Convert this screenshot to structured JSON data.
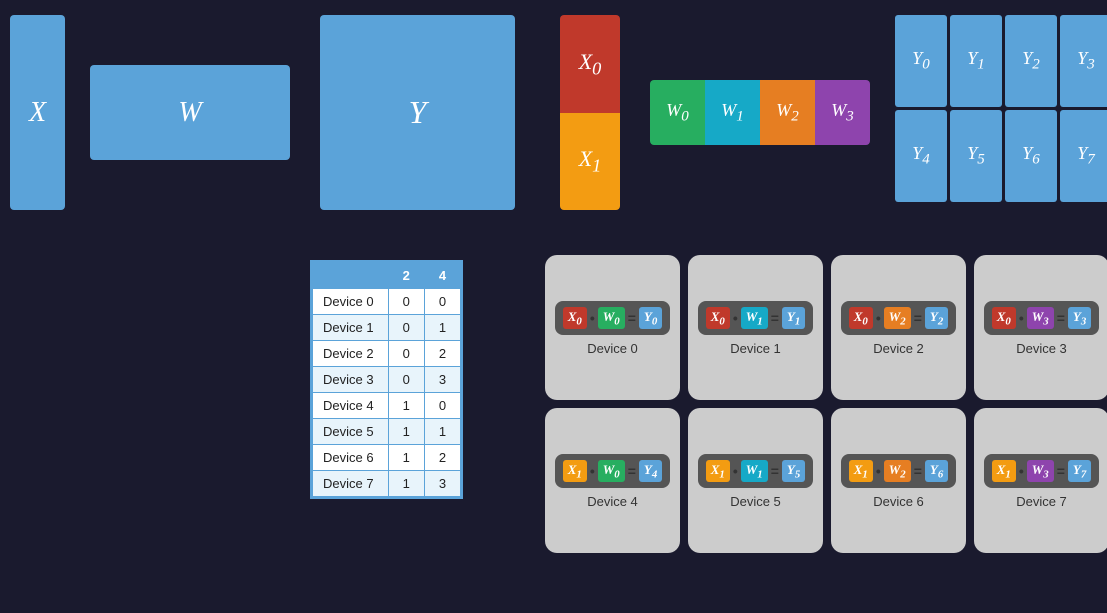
{
  "topSection": {
    "matrixX": "X",
    "matrixW": "W",
    "matrixY": "Y",
    "x0Label": "X₀",
    "x1Label": "X₁",
    "w0Label": "W₀",
    "w1Label": "W₁",
    "w2Label": "W₂",
    "w3Label": "W₃",
    "yCells": [
      "Y₀",
      "Y₁",
      "Y₂",
      "Y₃",
      "Y₄",
      "Y₅",
      "Y₆",
      "Y₇"
    ]
  },
  "table": {
    "col1": "",
    "col2": "2",
    "col3": "4",
    "rows": [
      {
        "device": "Device 0",
        "v2": "0",
        "v4": "0"
      },
      {
        "device": "Device 1",
        "v2": "0",
        "v4": "1"
      },
      {
        "device": "Device 2",
        "v2": "0",
        "v4": "2"
      },
      {
        "device": "Device 3",
        "v2": "0",
        "v4": "3"
      },
      {
        "device": "Device 4",
        "v2": "1",
        "v4": "0"
      },
      {
        "device": "Device 5",
        "v2": "1",
        "v4": "1"
      },
      {
        "device": "Device 6",
        "v2": "1",
        "v4": "2"
      },
      {
        "device": "Device 7",
        "v2": "1",
        "v4": "3"
      }
    ]
  },
  "devices": [
    {
      "id": 0,
      "xLabel": "X₀",
      "xClass": "red",
      "wLabel": "W₀",
      "wClass": "green",
      "yLabel": "Y₀",
      "yClass": "blue-out",
      "label": "Device 0"
    },
    {
      "id": 1,
      "xLabel": "X₀",
      "xClass": "red",
      "wLabel": "W₁",
      "wClass": "teal",
      "yLabel": "Y₁",
      "yClass": "blue-out",
      "label": "Device 1"
    },
    {
      "id": 2,
      "xLabel": "X₀",
      "xClass": "red",
      "wLabel": "W₂",
      "wClass": "orange2",
      "yLabel": "Y₂",
      "yClass": "blue-out",
      "label": "Device 2"
    },
    {
      "id": 3,
      "xLabel": "X₀",
      "xClass": "red",
      "wLabel": "W₃",
      "wClass": "purple",
      "yLabel": "Y₃",
      "yClass": "blue-out",
      "label": "Device 3"
    },
    {
      "id": 4,
      "xLabel": "X₁",
      "xClass": "orange",
      "wLabel": "W₀",
      "wClass": "green",
      "yLabel": "Y₄",
      "yClass": "blue-out",
      "label": "Device 4"
    },
    {
      "id": 5,
      "xLabel": "X₁",
      "xClass": "orange",
      "wLabel": "W₁",
      "wClass": "teal",
      "yLabel": "Y₅",
      "yClass": "blue-out",
      "label": "Device 5"
    },
    {
      "id": 6,
      "xLabel": "X₁",
      "xClass": "orange",
      "wLabel": "W₂",
      "wClass": "orange2",
      "yLabel": "Y₆",
      "yClass": "blue-out",
      "label": "Device 6"
    },
    {
      "id": 7,
      "xLabel": "X₁",
      "xClass": "orange",
      "wLabel": "W₃",
      "wClass": "purple",
      "yLabel": "Y₇",
      "yClass": "blue-out",
      "label": "Device 7"
    }
  ]
}
